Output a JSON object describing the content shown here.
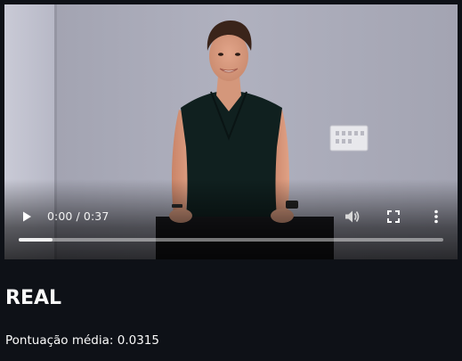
{
  "video": {
    "time_display": "0:00 / 0:37",
    "progress_fraction": 0.0,
    "buffered_fraction": 0.08,
    "icons": {
      "play": "play-icon",
      "volume": "volume-icon",
      "fullscreen": "fullscreen-icon",
      "more": "more-vertical-icon"
    }
  },
  "result": {
    "label": "REAL",
    "score_text": "Pontuação média: 0.0315"
  },
  "colors": {
    "background": "#0e1117",
    "text": "#fafafa",
    "wall": "#a9aab8",
    "shirt": "#0f1f21"
  }
}
